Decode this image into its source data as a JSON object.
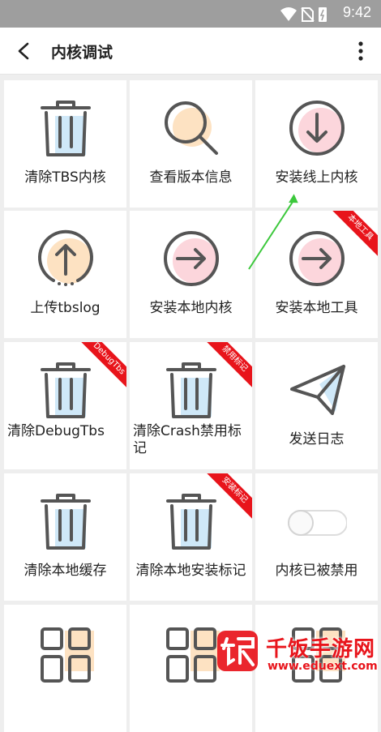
{
  "status_bar": {
    "time": "9:42"
  },
  "toolbar": {
    "title": "内核调试"
  },
  "grid": [
    {
      "label": "清除TBS内核",
      "icon": "trash-icon",
      "accent": "#cfe8f8"
    },
    {
      "label": "查看版本信息",
      "icon": "search-icon",
      "accent": "#fde2c2"
    },
    {
      "label": "安装线上内核",
      "icon": "download-icon",
      "accent": "#fcd6dc"
    },
    {
      "label": "上传tbslog",
      "icon": "upload-icon",
      "accent": "#fde2c2"
    },
    {
      "label": "安装本地内核",
      "icon": "arrow-right-icon",
      "accent": "#fcd6dc"
    },
    {
      "label": "安装本地工具",
      "icon": "arrow-right-icon",
      "accent": "#fcd6dc",
      "ribbon": "本地工具"
    },
    {
      "label": "清除DebugTbs",
      "icon": "trash-icon",
      "accent": "#cfe8f8",
      "ribbon": "DebugTbs"
    },
    {
      "label": "清除Crash禁用标记",
      "icon": "trash-icon",
      "accent": "#cfe8f8",
      "ribbon": "禁用标记"
    },
    {
      "label": "发送日志",
      "icon": "paper-plane-icon",
      "accent": "#cfe8f8"
    },
    {
      "label": "清除本地缓存",
      "icon": "trash-icon",
      "accent": "#cfe8f8"
    },
    {
      "label": "清除本地安装标记",
      "icon": "trash-icon",
      "accent": "#cfe8f8",
      "ribbon": "安装标记"
    },
    {
      "label": "内核已被禁用",
      "icon": "toggle-icon",
      "accent": "#eeeeee"
    },
    {
      "label": "",
      "icon": "grid-icon",
      "accent": "#fde2c2"
    },
    {
      "label": "",
      "icon": "grid-icon",
      "accent": "#fde2c2"
    },
    {
      "label": "",
      "icon": "grid-icon",
      "accent": "#fde2c2"
    }
  ],
  "watermark": {
    "title": "千饭手游网",
    "url": "www.eduext.com"
  },
  "colors": {
    "ribbon": "#e8141b",
    "annotation_arrow": "#3cc83c",
    "icon_stroke": "#555555"
  }
}
